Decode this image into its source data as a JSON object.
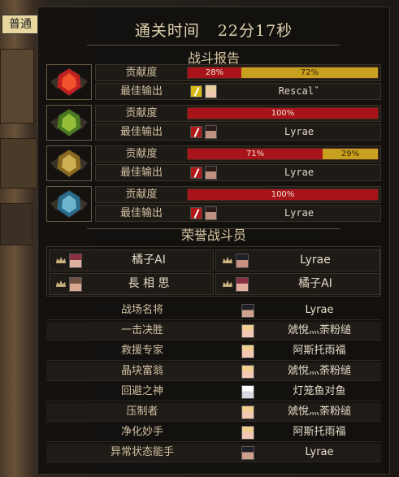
{
  "backdrop": {
    "tag": "普通"
  },
  "header": {
    "clear_time_label": "通关时间",
    "clear_time_value": "22分17秒"
  },
  "battle_report": {
    "title": "战斗报告",
    "contribution_label": "贡献度",
    "best_output_label": "最佳输出",
    "rows": [
      {
        "emblem": "red-flame-crest-icon",
        "segments": [
          {
            "label": "28%",
            "value": 28,
            "color": "red"
          },
          {
            "label": "72%",
            "value": 72,
            "color": "gold"
          }
        ],
        "weapon": "gold",
        "portrait": "light",
        "player": "Rescalˇ"
      },
      {
        "emblem": "green-leaf-crest-icon",
        "segments": [
          {
            "label": "100%",
            "value": 100,
            "color": "red"
          }
        ],
        "weapon": "red",
        "portrait": "dark",
        "player": "Lyrae"
      },
      {
        "emblem": "gold-horn-crest-icon",
        "segments": [
          {
            "label": "71%",
            "value": 71,
            "color": "red"
          },
          {
            "label": "29%",
            "value": 29,
            "color": "gold"
          }
        ],
        "weapon": "red",
        "portrait": "dark",
        "player": "Lyrae"
      },
      {
        "emblem": "blue-ice-crest-icon",
        "segments": [
          {
            "label": "100%",
            "value": 100,
            "color": "red"
          }
        ],
        "weapon": "red",
        "portrait": "dark",
        "player": "Lyrae"
      }
    ]
  },
  "honor": {
    "title": "荣誉战斗员",
    "fighters": [
      {
        "name": "橘子AI",
        "portrait": "pink"
      },
      {
        "name": "Lyrae",
        "portrait": "dark"
      },
      {
        "name": "長 相 思",
        "portrait": "plain"
      },
      {
        "name": "橘子AI",
        "portrait": "pink"
      }
    ]
  },
  "awards": [
    {
      "title": "战场名将",
      "player": "Lyrae",
      "portrait": "dark"
    },
    {
      "title": "一击决胜",
      "player": "虠悅灬荼粉缒",
      "portrait": "blonde"
    },
    {
      "title": "救援专家",
      "player": "阿斯托雨福",
      "portrait": "blonde"
    },
    {
      "title": "晶块富翁",
      "player": "虠悅灬荼粉缒",
      "portrait": "blonde"
    },
    {
      "title": "回避之神",
      "player": "灯笼鱼对鱼",
      "portrait": "white"
    },
    {
      "title": "压制者",
      "player": "虠悅灬荼粉缒",
      "portrait": "blonde"
    },
    {
      "title": "净化妙手",
      "player": "阿斯托雨福",
      "portrait": "blonde"
    },
    {
      "title": "异常状态能手",
      "player": "Lyrae",
      "portrait": "dark"
    }
  ],
  "colors": {
    "bar_red": "#a8141a",
    "bar_gold": "#c8a020",
    "panel_bg": "#12100e"
  }
}
